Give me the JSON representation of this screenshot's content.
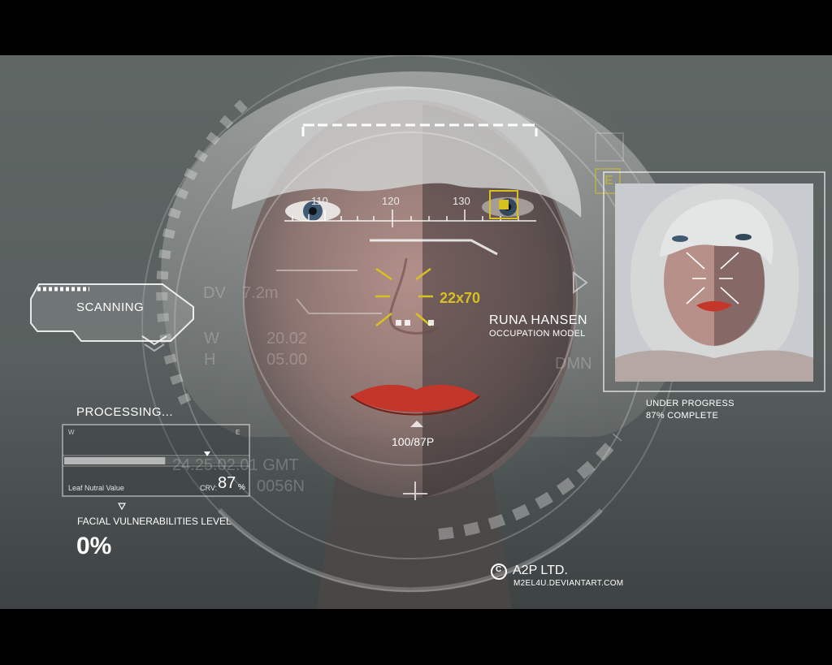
{
  "scanning_label": "SCANNING",
  "processing": {
    "label": "PROCESSING...",
    "panel_tl": "W",
    "panel_tr": "E",
    "leaf_label": "Leaf Nutral Value",
    "crv_label": "CRV:",
    "crv_value": "87",
    "crv_unit": "%",
    "progress": 0.55
  },
  "vulnerability": {
    "label": "FACIAL VULNERABILITIES LEVEL",
    "value": "0%"
  },
  "readouts": {
    "dv": "DV",
    "dv_value": "7.2m",
    "w": "W",
    "w_value": "20.02",
    "h": "H",
    "h_value": "05.00",
    "dmn": "DMN",
    "gmt": "24.25.02.01 GMT",
    "coord": "0056N"
  },
  "scale_ticks": [
    "110",
    "120",
    "130"
  ],
  "target_size": "22x70",
  "bottom_marker": "100/87P",
  "subject": {
    "name": "RUNA HANSEN",
    "role": "OCCUPATION MODEL"
  },
  "thumbnail_status": {
    "line1": "UNDER PROGRESS",
    "line2": "87% COMPLETE",
    "corner": "E"
  },
  "credit": {
    "company": "A2P LTD.",
    "url": "M2EL4U.DEVIANTART.COM",
    "copyright_symbol": "C"
  },
  "colors": {
    "hud_white": "#ffffff",
    "accent_yellow": "#d8c020",
    "lip_red": "#c4352a",
    "background": "#5c6361"
  }
}
